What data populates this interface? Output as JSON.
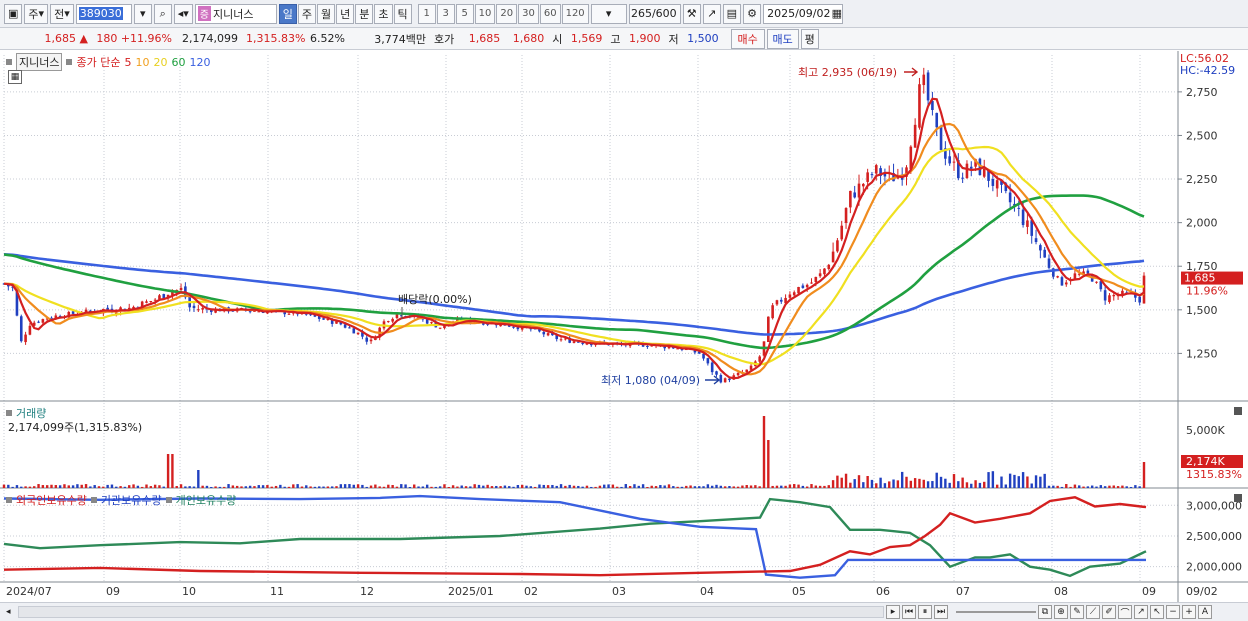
{
  "toolbar": {
    "type_label": "주",
    "prev_label": "전",
    "code": "389030",
    "name_tag": "증",
    "name": "지니너스",
    "periods": [
      "일",
      "주",
      "월",
      "년",
      "분",
      "초",
      "틱"
    ],
    "active_period": "일",
    "intervals": [
      "1",
      "3",
      "5",
      "10",
      "20",
      "30",
      "60",
      "120"
    ],
    "count": "265",
    "count_total": "/600",
    "date": "2025/09/02"
  },
  "quote": {
    "price": "1,685",
    "change": "180",
    "change_pct": "+11.96%",
    "volume": "2,174,099",
    "volume_pct": "1,315.83%",
    "turnover": "6.52%",
    "amount": "3,774백만",
    "hoga_label": "호가",
    "hoga_ask": "1,685",
    "hoga_bid": "1,680",
    "open_label": "시",
    "open": "1,569",
    "high_label": "고",
    "high": "1,900",
    "low_label": "저",
    "low": "1,500",
    "buy_label": "매수",
    "sell_label": "매도",
    "avg_label": "평"
  },
  "legend": {
    "stock_label": "지니너스",
    "ma_label": "종가 단순",
    "ma_periods": [
      "5",
      "10",
      "20",
      "60",
      "120"
    ],
    "lc": "LC:56.02",
    "hc": "HC:-42.59",
    "volume_title": "거래량",
    "volume_value": "2,174,099주(1,315.83%)",
    "holders": [
      "외국인보유수량",
      "기관보유수량",
      "개인보유수량"
    ]
  },
  "annotations": {
    "high": "최고 2,935 (06/19)",
    "low": "최저 1,080 (04/09)",
    "dividend": "배당락(0.00%)",
    "price_tag": "1,685",
    "pct_tag": "11.96%",
    "vol_tag": "2,174K",
    "vol_pct_tag": "1315.83%",
    "bottom_date": "09/02"
  },
  "colors": {
    "ma5": "#d42020",
    "ma10": "#f08c1e",
    "ma20": "#f0e020",
    "ma60": "#20a040",
    "ma120": "#3a60e0",
    "up": "#d42020",
    "down": "#2040c0"
  },
  "chart_data": [
    {
      "type": "candlestick",
      "title": "",
      "x_ticks": [
        "2024/07",
        "09",
        "10",
        "11",
        "12",
        "2025/01",
        "02",
        "03",
        "04",
        "05",
        "06",
        "07",
        "08",
        "09"
      ],
      "y_ticks": [
        1250,
        1500,
        1750,
        2000,
        2250,
        2500,
        2750
      ],
      "ylim": [
        1000,
        2950
      ],
      "series": [
        {
          "name": "종가",
          "points": [
            [
              "2024/07",
              1650
            ],
            [
              "2024/07m",
              1300
            ],
            [
              "2024/08",
              1480
            ],
            [
              "2024/09",
              1500
            ],
            [
              "2024/09m",
              1560
            ],
            [
              "2024/10",
              1620
            ],
            [
              "2024/10m",
              1510
            ],
            [
              "2024/11",
              1500
            ],
            [
              "2024/11m",
              1420
            ],
            [
              "2024/12",
              1310
            ],
            [
              "2024/12m",
              1480
            ],
            [
              "2025/01",
              1430
            ],
            [
              "2025/01m",
              1420
            ],
            [
              "2025/02",
              1380
            ],
            [
              "2025/02m",
              1320
            ],
            [
              "2025/03",
              1320
            ],
            [
              "2025/03m",
              1300
            ],
            [
              "2025/04",
              1250
            ],
            [
              "2025/04/09",
              1080
            ],
            [
              "2025/04m",
              1200
            ],
            [
              "2025/05",
              1700
            ],
            [
              "2025/05m",
              2100
            ],
            [
              "2025/06",
              2300
            ],
            [
              "2025/06/19",
              2935
            ],
            [
              "2025/06m",
              2450
            ],
            [
              "2025/07",
              2350
            ],
            [
              "2025/07m",
              2200
            ],
            [
              "2025/08",
              1900
            ],
            [
              "2025/08m",
              1650
            ],
            [
              "2025/09",
              1550
            ],
            [
              "2025/09/02",
              1685
            ]
          ]
        }
      ]
    },
    {
      "type": "bar",
      "title": "거래량",
      "y_ticks": [
        "5,000K"
      ],
      "last": 2174099
    },
    {
      "type": "line",
      "y_ticks": [
        2000000,
        2500000,
        3000000
      ],
      "series": [
        {
          "name": "외국인보유수량"
        },
        {
          "name": "기관보유수량"
        },
        {
          "name": "개인보유수량"
        }
      ]
    }
  ]
}
